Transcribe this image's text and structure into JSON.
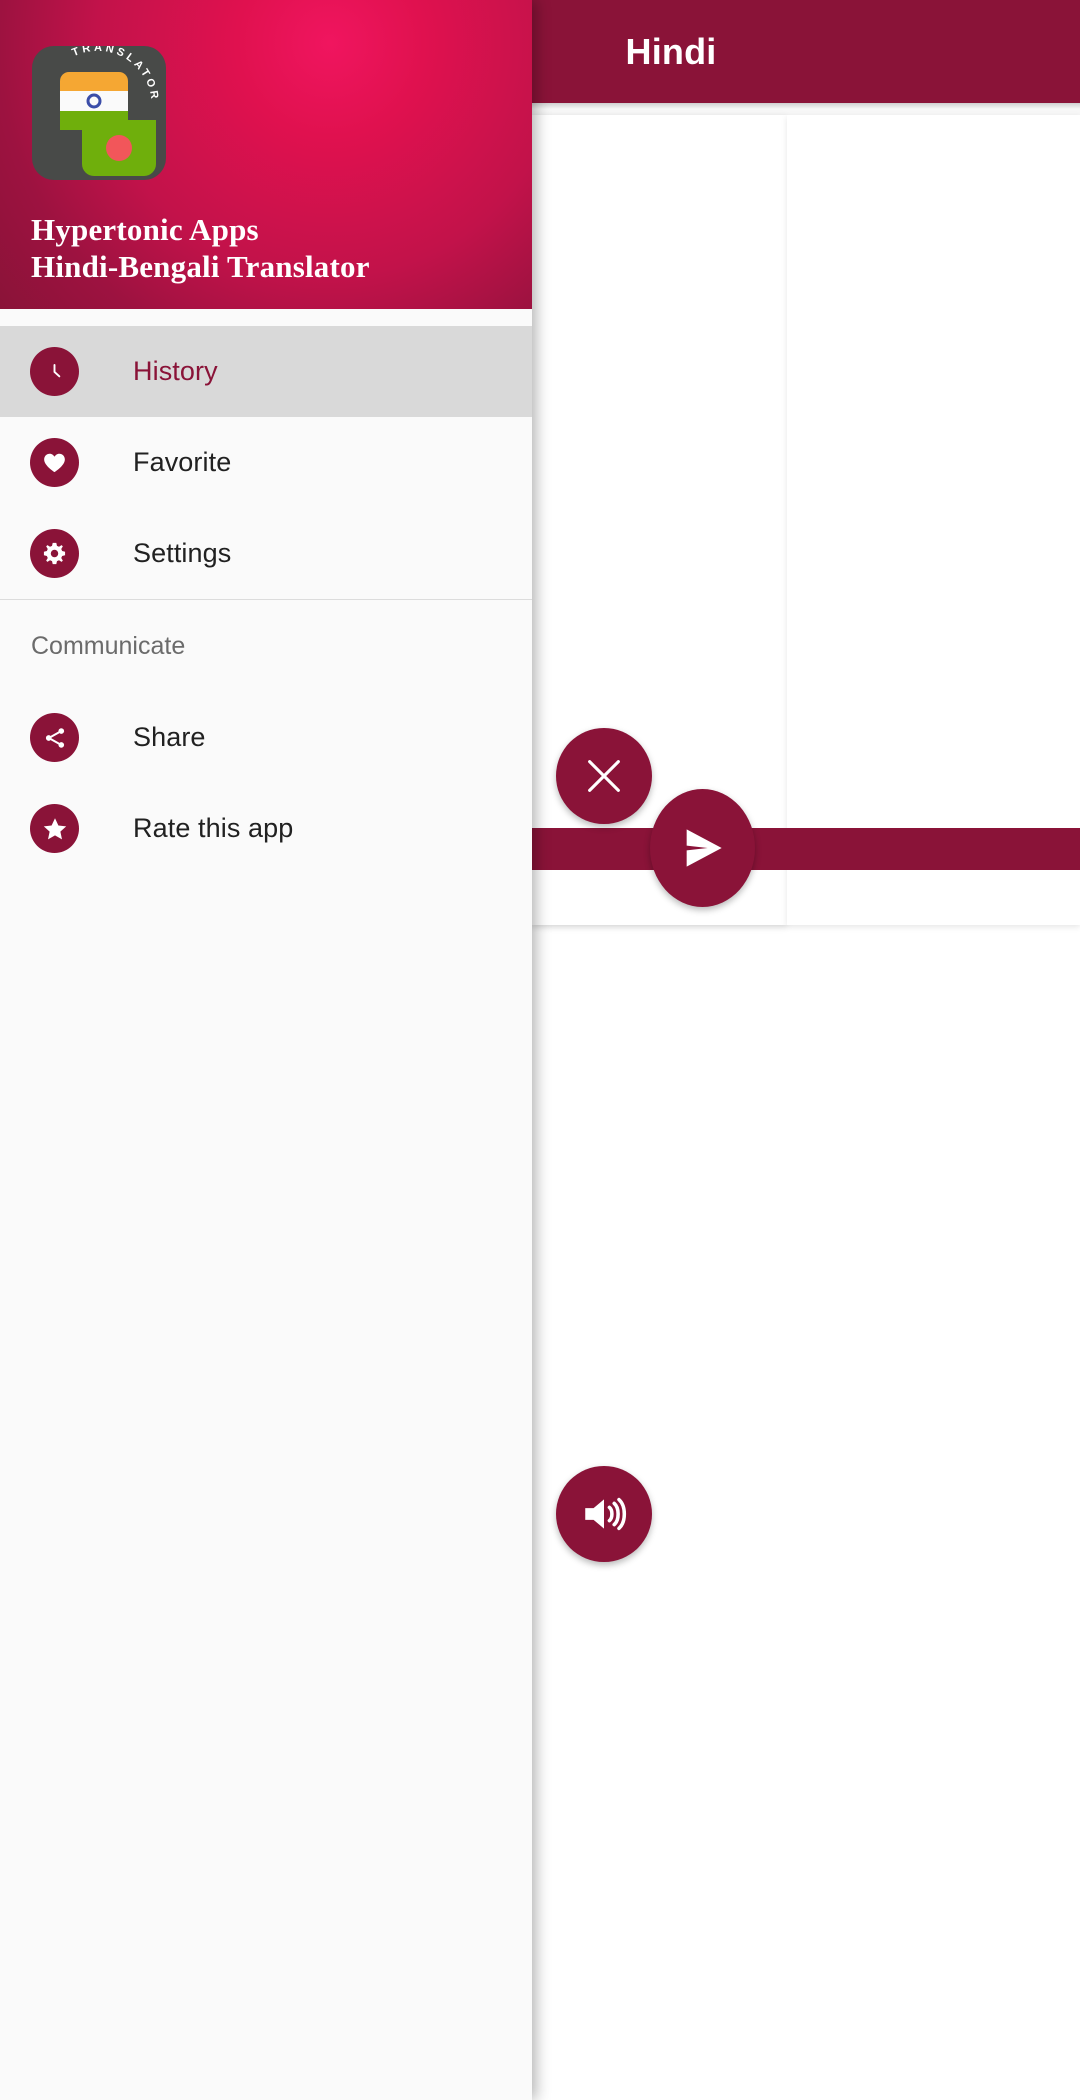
{
  "background_app": {
    "appbar": {
      "title": "Hindi"
    },
    "buttons": {
      "clear_label": "Clear",
      "send_label": "Translate",
      "speak_label": "Speak"
    },
    "colors": {
      "primary": "#8a1338",
      "card": "#ffffff"
    }
  },
  "drawer": {
    "header": {
      "icon_name": "app-logo-translator",
      "icon_arc_text": "TRANSLATOR",
      "title_line1": "Hypertonic Apps",
      "title_line2": "Hindi-Bengali Translator"
    },
    "primary_items": [
      {
        "label": "History",
        "icon": "clock-icon",
        "selected": true
      },
      {
        "label": "Favorite",
        "icon": "heart-icon",
        "selected": false
      },
      {
        "label": "Settings",
        "icon": "gear-icon",
        "selected": false
      }
    ],
    "section": {
      "label": "Communicate"
    },
    "secondary_items": [
      {
        "label": "Share",
        "icon": "share-icon",
        "selected": false
      },
      {
        "label": "Rate this app",
        "icon": "star-icon",
        "selected": false
      }
    ],
    "colors": {
      "gradient_start": "#f0155f",
      "gradient_end": "#8a1338",
      "icon_bg": "#8a1338",
      "selected_bg": "#d9d9d9",
      "selected_text": "#8a1338"
    }
  }
}
